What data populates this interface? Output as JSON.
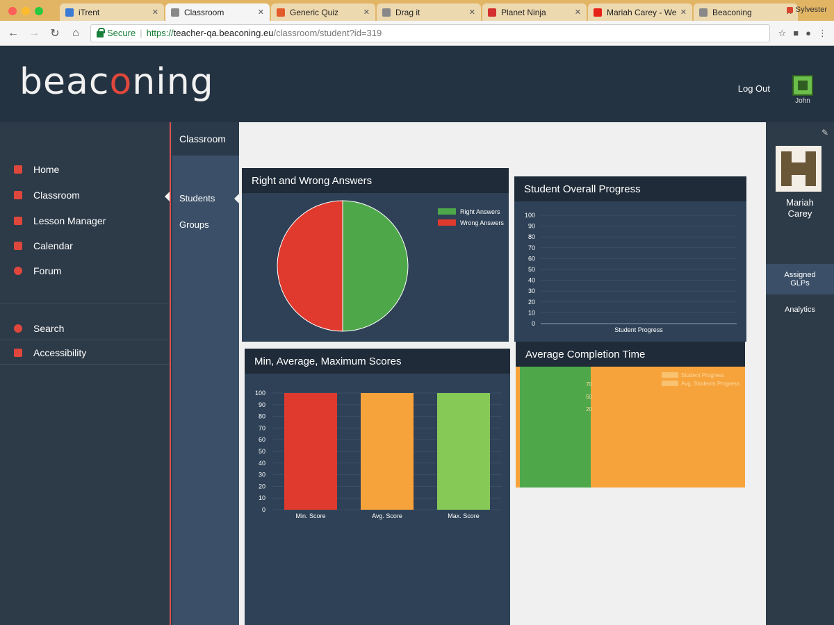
{
  "browser": {
    "tabs": [
      {
        "label": "iTrent",
        "icon_color": "#3a7bd5"
      },
      {
        "label": "Classroom",
        "icon_color": "#888888",
        "active": true
      },
      {
        "label": "Generic Quiz",
        "icon_color": "#e35b2a"
      },
      {
        "label": "Drag it",
        "icon_color": "#888888"
      },
      {
        "label": "Planet Ninja",
        "icon_color": "#d32f2f"
      },
      {
        "label": "Mariah Carey - We Belon",
        "icon_color": "#e62117"
      },
      {
        "label": "Beaconing",
        "icon_color": "#888888"
      }
    ],
    "profile_name": "Sylvester",
    "secure_label": "Secure",
    "url_scheme": "https://",
    "url_host": "teacher-qa.beaconing.eu",
    "url_path": "/classroom/student?id=319"
  },
  "header": {
    "logo_start": "beac",
    "logo_accent": "o",
    "logo_end": "ning",
    "logout_label": "Log Out",
    "user_name": "John"
  },
  "sidenav": {
    "items": [
      {
        "label": "Home",
        "icon": "home-icon",
        "color": "#e0473c"
      },
      {
        "label": "Classroom",
        "icon": "graduation-cap-icon",
        "color": "#e0473c"
      },
      {
        "label": "Lesson Manager",
        "icon": "pencil-icon",
        "color": "#e0473c"
      },
      {
        "label": "Calendar",
        "icon": "calendar-icon",
        "color": "#e0473c"
      },
      {
        "label": "Forum",
        "icon": "chat-bubble-icon",
        "color": "#e0473c"
      },
      {
        "label": "Search",
        "icon": "search-icon",
        "color": "#e0473c"
      },
      {
        "label": "Accessibility",
        "icon": "key-icon",
        "color": "#e0473c"
      }
    ]
  },
  "subnav": {
    "title": "Classroom",
    "items": [
      "Students",
      "Groups"
    ]
  },
  "profile": {
    "name_first": "Mariah",
    "name_last": "Carey",
    "assigned_line1": "Assigned",
    "assigned_line2": "GLPs",
    "analytics_label": "Analytics"
  },
  "panels": {
    "right_wrong_title": "Right and Wrong Answers",
    "progress_title": "Student Overall Progress",
    "scores_title": "Min, Average, Maximum Scores",
    "completion_title": "Average Completion Time"
  },
  "colors": {
    "green": "#4ea84a",
    "red": "#e03a2f",
    "orange": "#f7a33c",
    "light_green": "#86c956"
  },
  "chart_data": [
    {
      "type": "pie",
      "title": "Right and Wrong Answers",
      "slices": [
        {
          "name": "Right Answers",
          "value": 50,
          "color": "#4ea84a"
        },
        {
          "name": "Wrong Answers",
          "value": 50,
          "color": "#e03a2f"
        }
      ],
      "legend": "top-right"
    },
    {
      "type": "bar",
      "title": "Student Overall Progress",
      "categories": [
        "Student Progress"
      ],
      "values": [
        0
      ],
      "ylim": [
        0,
        100
      ],
      "yticks": [
        0,
        10,
        20,
        30,
        40,
        50,
        60,
        70,
        80,
        90,
        100
      ]
    },
    {
      "type": "bar",
      "title": "Min, Average, Maximum Scores",
      "categories": [
        "Min. Score",
        "Avg. Score",
        "Max. Score"
      ],
      "values": [
        100,
        100,
        100
      ],
      "colors": [
        "#e03a2f",
        "#f7a33c",
        "#86c956"
      ],
      "ylim": [
        0,
        100
      ],
      "yticks": [
        0,
        10,
        20,
        30,
        40,
        50,
        60,
        70,
        80,
        90,
        100
      ]
    },
    {
      "type": "area",
      "title": "Average Completion Time",
      "series": [
        {
          "name": "Student Progress",
          "color": "#4ea84a"
        },
        {
          "name": "Avg. Students Progress",
          "color": "#f7a33c"
        }
      ],
      "yticks": [
        20,
        50,
        70
      ],
      "legend": "top-right"
    }
  ]
}
